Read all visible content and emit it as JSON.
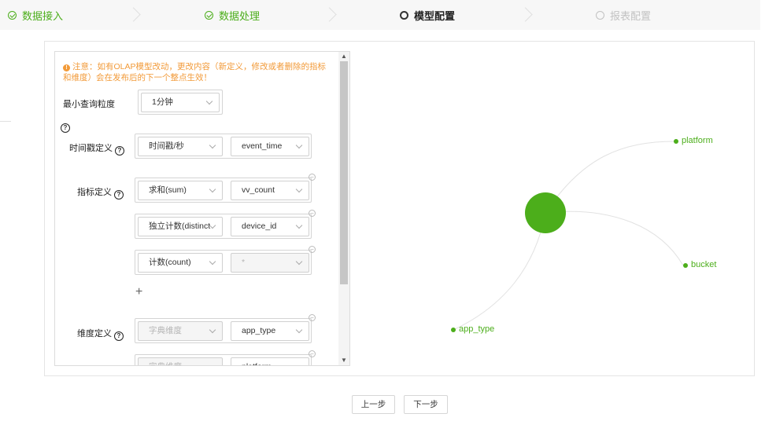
{
  "steps": [
    {
      "label": "数据接入",
      "state": "done"
    },
    {
      "label": "数据处理",
      "state": "done"
    },
    {
      "label": "模型配置",
      "state": "active"
    },
    {
      "label": "报表配置",
      "state": "todo"
    }
  ],
  "form": {
    "notice": "注意：如有OLAP模型改动，更改内容（新定义，修改或者删除的指标和维度）会在发布后的下一个整点生效！",
    "min_granularity": {
      "label": "最小查询粒度",
      "value": "1分钟"
    },
    "timestamp": {
      "label": "时间戳定义",
      "type": "时间戳/秒",
      "field": "event_time"
    },
    "metrics": {
      "label": "指标定义",
      "rows": [
        {
          "agg": "求和(sum)",
          "field": "vv_count"
        },
        {
          "agg": "独立计数(distinct",
          "field": "device_id"
        },
        {
          "agg": "计数(count)",
          "field": "*"
        }
      ]
    },
    "dimensions": {
      "label": "维度定义",
      "rows": [
        {
          "type": "字典维度",
          "field": "app_type"
        },
        {
          "type": "字典维度",
          "field": "platform"
        }
      ]
    }
  },
  "graph": {
    "colors": {
      "accent": "#4cae1b",
      "link": "#e2e2e2"
    },
    "nodes": [
      {
        "label": "platform"
      },
      {
        "label": "bucket"
      },
      {
        "label": "app_type"
      }
    ]
  },
  "buttons": {
    "prev": "上一步",
    "next": "下一步"
  }
}
